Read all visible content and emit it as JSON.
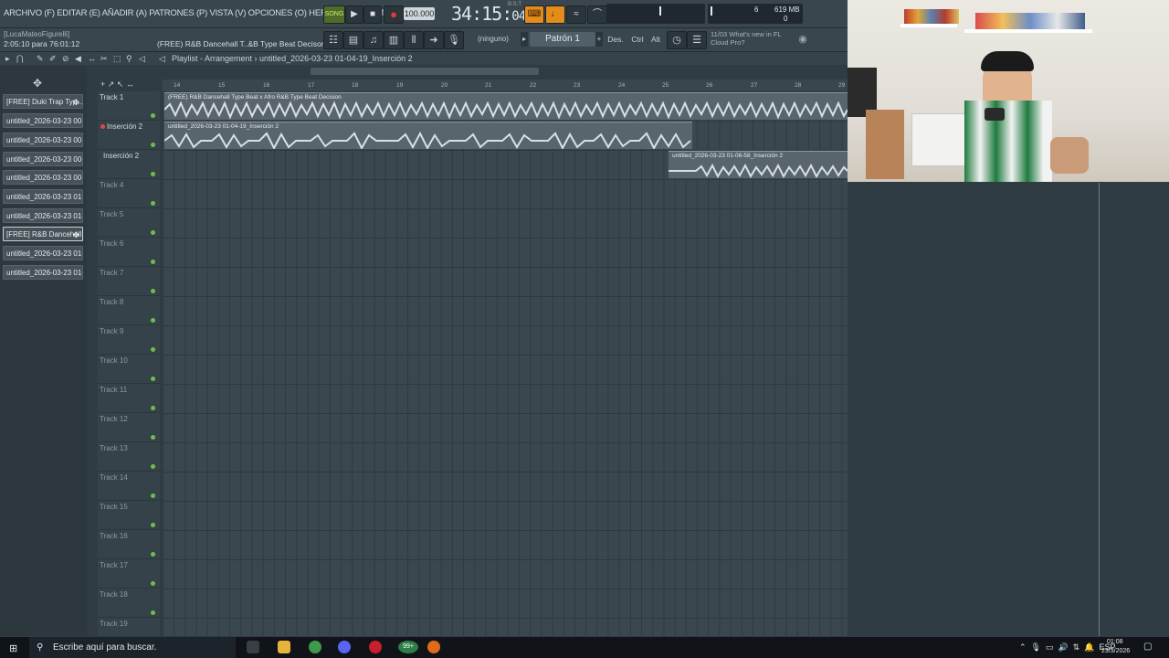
{
  "menu": {
    "text": "ARCHIVO (F) EDITAR (E) AÑADIR (A) PATRONES (P) VISTA (V) OPCIONES (O) HERRAMIENTAS (T) AYUDA"
  },
  "transport": {
    "song_label": "SONG",
    "tempo": "100.000",
    "time": "34:15",
    "time_frac": "04",
    "time_sub": "B:S:T",
    "cpu": "6",
    "memory": "619 MB",
    "cpu_zero": "0"
  },
  "status": {
    "user": "[LucaMateoFigurelli]",
    "elapsed": "2:05:10 para 76:01:12",
    "hint": "(FREE) R&B Dancehall T..&B Type Beat Decison"
  },
  "toolbar2": {
    "pattern_select": "(ninguno)",
    "pattern": "Patrón 1",
    "des": "Des.",
    "ctrl": "Ctrl",
    "alt": "Alt",
    "news_date": "11/03",
    "news_text": "What's new in FL Cloud Pro?"
  },
  "playlist": {
    "title": "Playlist - Arrangement",
    "breadcrumb": "untitled_2026-03-23 01-04-19_Inserción 2"
  },
  "picker": {
    "clips": [
      "[FREE] Duki Trap Typ...",
      "untitled_2026-03-23 00-...",
      "untitled_2026-03-23 00-...",
      "untitled_2026-03-23 00-...",
      "untitled_2026-03-23 00-...",
      "untitled_2026-03-23 01-...",
      "untitled_2026-03-23 01-...",
      "[FREE] R&B Dancehall...",
      "untitled_2026-03-23 01-...",
      "untitled_2026-03-23 01-..."
    ]
  },
  "tracks": [
    "Track 1",
    "Inserción 2",
    "Inserción 2",
    "Track 4",
    "Track 5",
    "Track 6",
    "Track 7",
    "Track 8",
    "Track 9",
    "Track 10",
    "Track 11",
    "Track 12",
    "Track 13",
    "Track 14",
    "Track 15",
    "Track 16",
    "Track 17",
    "Track 18",
    "Track 19"
  ],
  "ruler": [
    "14",
    "15",
    "16",
    "17",
    "18",
    "19",
    "20",
    "21",
    "22",
    "23",
    "24",
    "25",
    "26",
    "27",
    "28",
    "29"
  ],
  "clips": {
    "c1": "(FREE) R&B Dancehall Type Beat x Afro R&B Type Beat Decision",
    "c2": "untitled_2026-03-23 01-04-19_Inserción 2",
    "c3": "untitled_2026-03-23 01-06-58_Inserción 2"
  },
  "taskbar": {
    "search": "Escribe aquí para buscar.",
    "lang": "ESP",
    "time": "01:08",
    "date": "23/3/2026",
    "badge": "99+"
  }
}
